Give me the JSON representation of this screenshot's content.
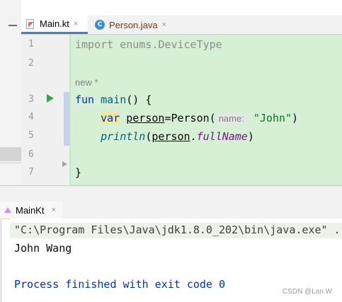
{
  "tabs": [
    {
      "label": "Main.kt",
      "active": true
    },
    {
      "label": "Person.java",
      "active": false
    }
  ],
  "tab_close_glyph": "×",
  "java_icon_letter": "C",
  "line_numbers": [
    "1",
    "2",
    "3",
    "4",
    "5",
    "6",
    "7"
  ],
  "code": {
    "line1": "import enums.DeviceType",
    "author_hint": "new *",
    "line3_kw": "fun",
    "line3_fn": "main",
    "line3_rest": "() {",
    "line4_var": "var",
    "line4_name": "person",
    "line4_call": "=Person(",
    "line4_param_hint": "name:",
    "line4_arg": "\"John\"",
    "line4_close": ")",
    "line5_fn": "println",
    "line5_open": "(",
    "line5_obj": "person",
    "line5_dot": ".",
    "line5_prop": "fullName",
    "line5_close": ")",
    "line7": "}"
  },
  "run_panel": {
    "tab_label": "MainKt",
    "command_line": "\"C:\\Program Files\\Java\\jdk1.8.0_202\\bin\\java.exe\" ...",
    "output_line": "John Wang",
    "exit_line": "Process finished with exit code 0"
  },
  "watermark": "CSDN @Lan.W",
  "colors": {
    "editor_bg": "#d5f0d5",
    "keyword": "#0033b3",
    "string": "#067d17",
    "property": "#871094",
    "tab_accent": "#4083c9"
  },
  "icons": [
    "kotlin-file-icon",
    "java-class-icon",
    "run-gutter-icon",
    "fold-icon",
    "run-config-icon",
    "close-icon"
  ]
}
